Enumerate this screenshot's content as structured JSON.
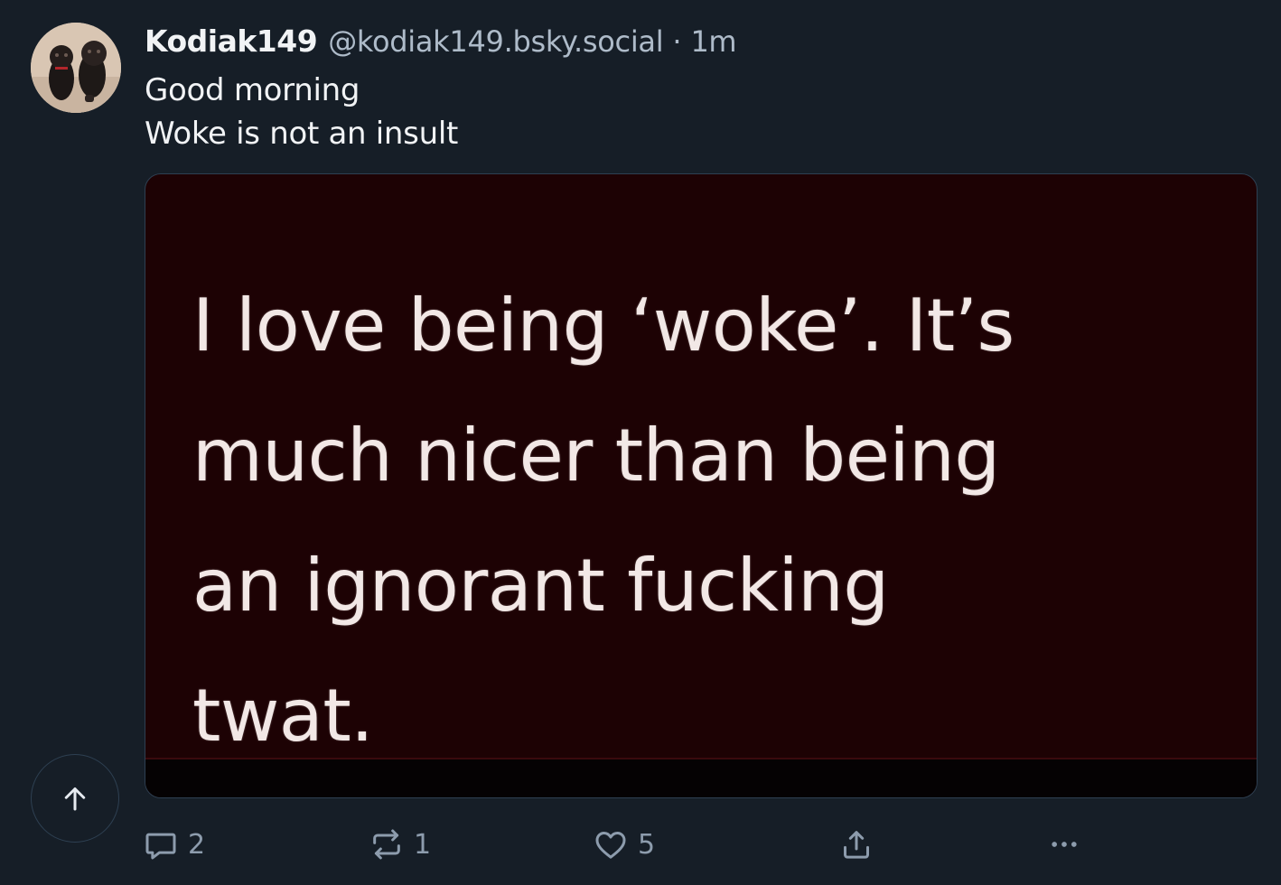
{
  "author": {
    "display_name": "Kodiak149",
    "handle": "@kodiak149.bsky.social",
    "separator": "·",
    "time": "1m"
  },
  "post": {
    "lines": [
      "Good morning",
      "Woke is not an insult"
    ]
  },
  "embed": {
    "image_lines": [
      "I love being ‘woke’. It’s",
      "much nicer than being",
      "an ignorant fucking",
      "twat."
    ]
  },
  "actions": {
    "reply_count": "2",
    "repost_count": "1",
    "like_count": "5"
  },
  "icons": {
    "reply": "speech-bubble-icon",
    "repost": "repost-arrows-icon",
    "like": "heart-icon",
    "share": "share-upload-icon",
    "more": "ellipsis-icon",
    "scroll_top": "arrow-up-icon"
  },
  "colors": {
    "background": "#161e27",
    "text_primary": "#f1f3f5",
    "text_secondary": "#aebbc9",
    "icon_muted": "#8d9cad",
    "image_background": "#1d0204"
  }
}
